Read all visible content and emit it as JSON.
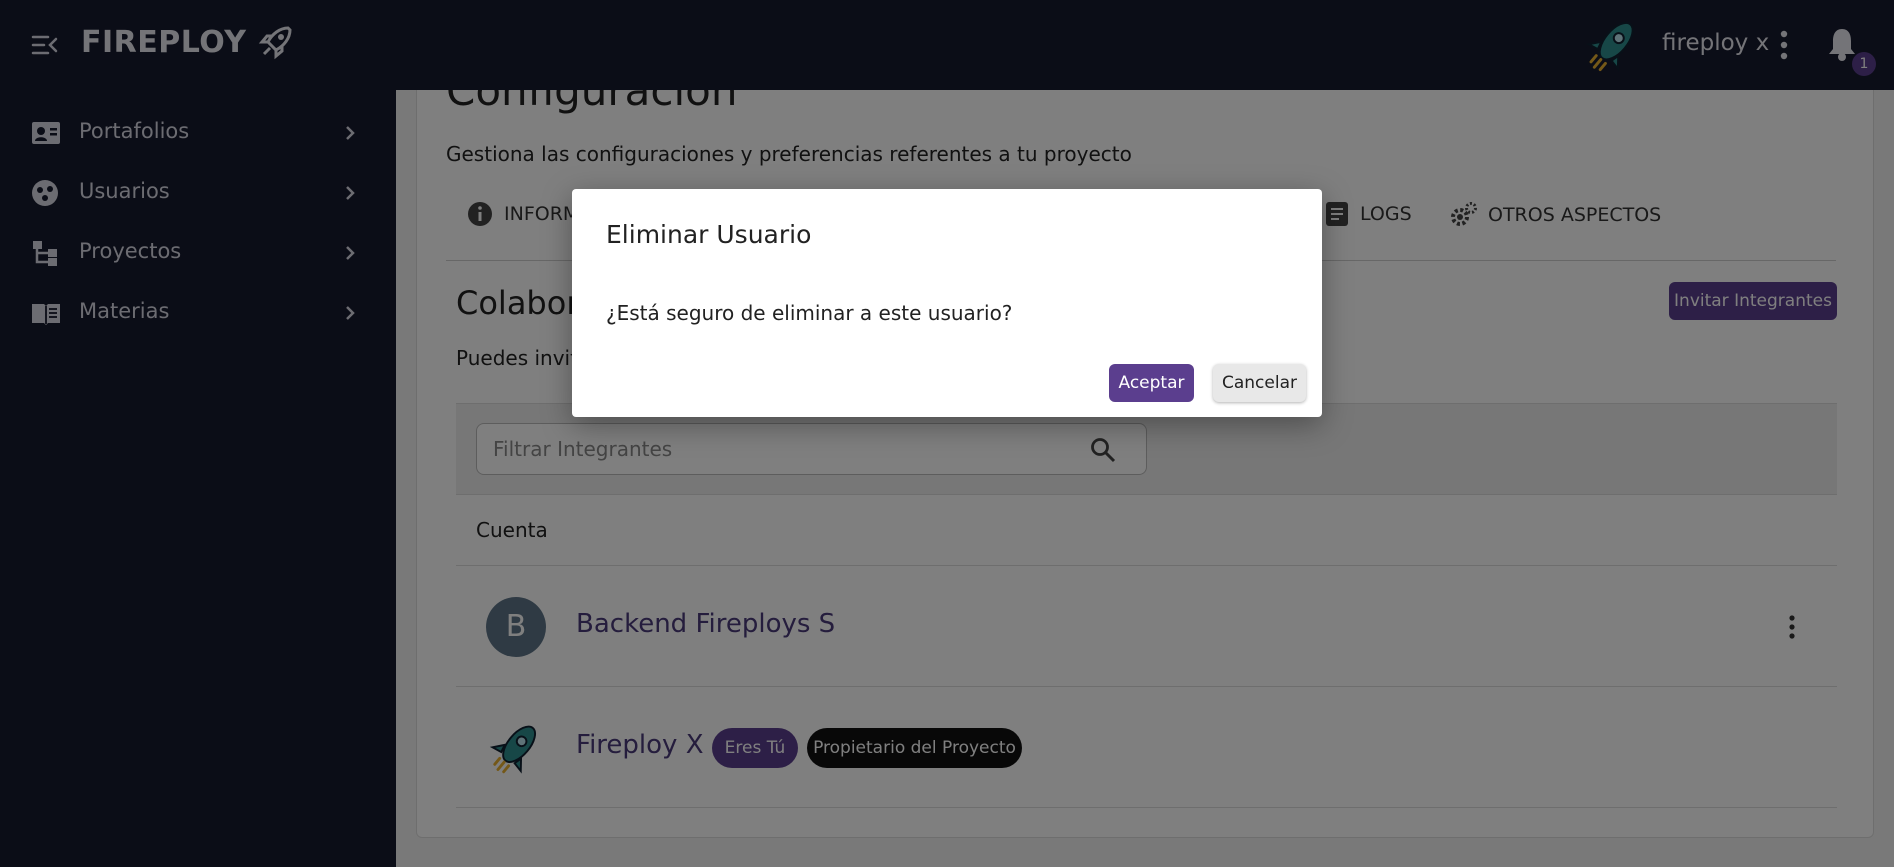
{
  "header": {
    "brand": "FIREPLOY",
    "user_name": "fireploy x",
    "notification_count": "1"
  },
  "sidebar": {
    "items": [
      {
        "label": "Portafolios",
        "icon": "portfolio-card-icon"
      },
      {
        "label": "Usuarios",
        "icon": "users-group-icon"
      },
      {
        "label": "Proyectos",
        "icon": "projects-tree-icon"
      },
      {
        "label": "Materias",
        "icon": "book-icon"
      }
    ]
  },
  "main": {
    "title": "Configuración",
    "subtitle": "Gestiona las configuraciones y preferencias referentes a tu proyecto",
    "tabs": [
      {
        "label": "INFORM",
        "icon": "info-icon"
      },
      {
        "label": "LOGS",
        "icon": "logs-icon"
      },
      {
        "label": "OTROS ASPECTOS",
        "icon": "gears-icon"
      }
    ],
    "section_title": "Colabora",
    "section_subtitle": "Puedes invita",
    "invite_button": "Invitar Integrantes",
    "search_placeholder": "Filtrar Integrantes",
    "column_header": "Cuenta",
    "rows": [
      {
        "avatar_letter": "B",
        "name": "Backend Fireploys S"
      },
      {
        "name": "Fireploy X",
        "badges": [
          "Eres Tú",
          "Propietario del Proyecto"
        ]
      }
    ]
  },
  "dialog": {
    "title": "Eliminar Usuario",
    "message": "¿Está seguro de eliminar a este usuario?",
    "accept": "Aceptar",
    "cancel": "Cancelar"
  },
  "colors": {
    "nav_background": "#171a2e",
    "accent": "#5b3e8e",
    "owner_badge": "#111111",
    "overlay": "rgba(0,0,0,0.5)"
  }
}
